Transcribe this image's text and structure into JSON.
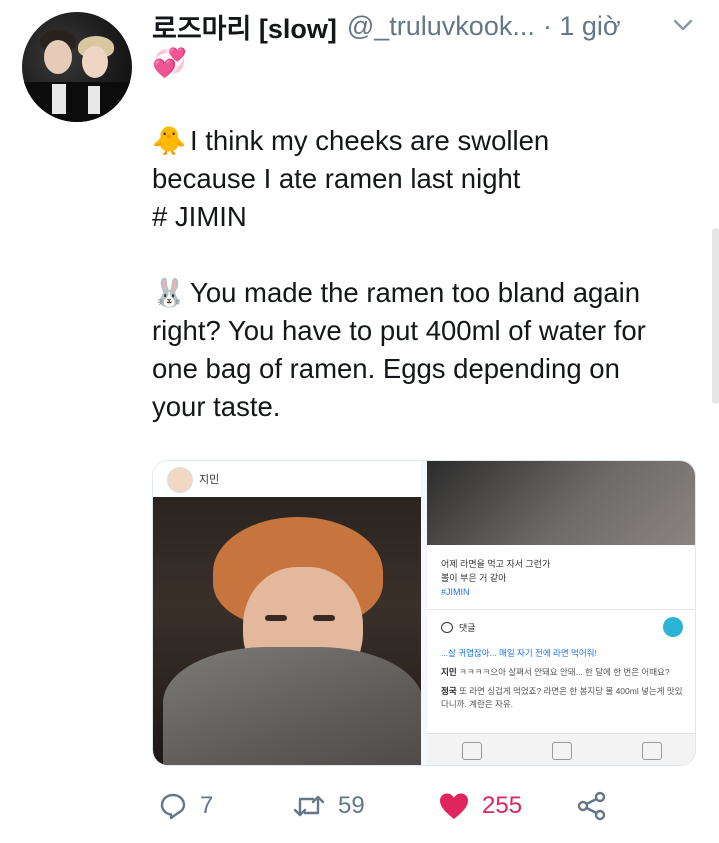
{
  "tweet": {
    "display_name": "로즈마리 [slow]",
    "handle": "@_truluvkook...",
    "time": "· 1 giờ",
    "name_emoji": "💞",
    "lines": [
      {
        "emoji": "🐥",
        "text": "I think my cheeks are swollen"
      },
      {
        "text": "because I ate ramen last night"
      },
      {
        "text": "# JIMIN"
      },
      {
        "emoji": "🐰",
        "text": "You made the ramen too bland again"
      },
      {
        "text": "right? You have to put 400ml of water for"
      },
      {
        "text": "one bag of ramen. Eggs depending on"
      },
      {
        "text": "your taste."
      }
    ]
  },
  "media": {
    "left_post_name": "지민",
    "right_caption_line1": "어제 라면을 먹고 자서 그런가",
    "right_caption_line2": "볼이 부은 거 같아",
    "right_caption_tag": "#JIMIN",
    "comments_label": "댓글",
    "comment1": "...살 귀엽잖아... 매일 자기 전에 라면 먹어줘!",
    "comment2_name": "지민",
    "comment2_text": "ㅋㅋㅋㅋ으아 살쪄서 안돼요 안돼... 한 달에 한 번은 어때요?",
    "comment3_name": "정국",
    "comment3_text": "또 라면 싱겁게 먹었죠? 라면은 한 봉지당 물 400ml 넣는게 맛있다니까. 계란은 자유."
  },
  "actions": {
    "reply_count": "7",
    "retweet_count": "59",
    "like_count": "255"
  },
  "colors": {
    "like": "#e0245e",
    "secondary_text": "#657786",
    "primary_text": "#14171a"
  }
}
